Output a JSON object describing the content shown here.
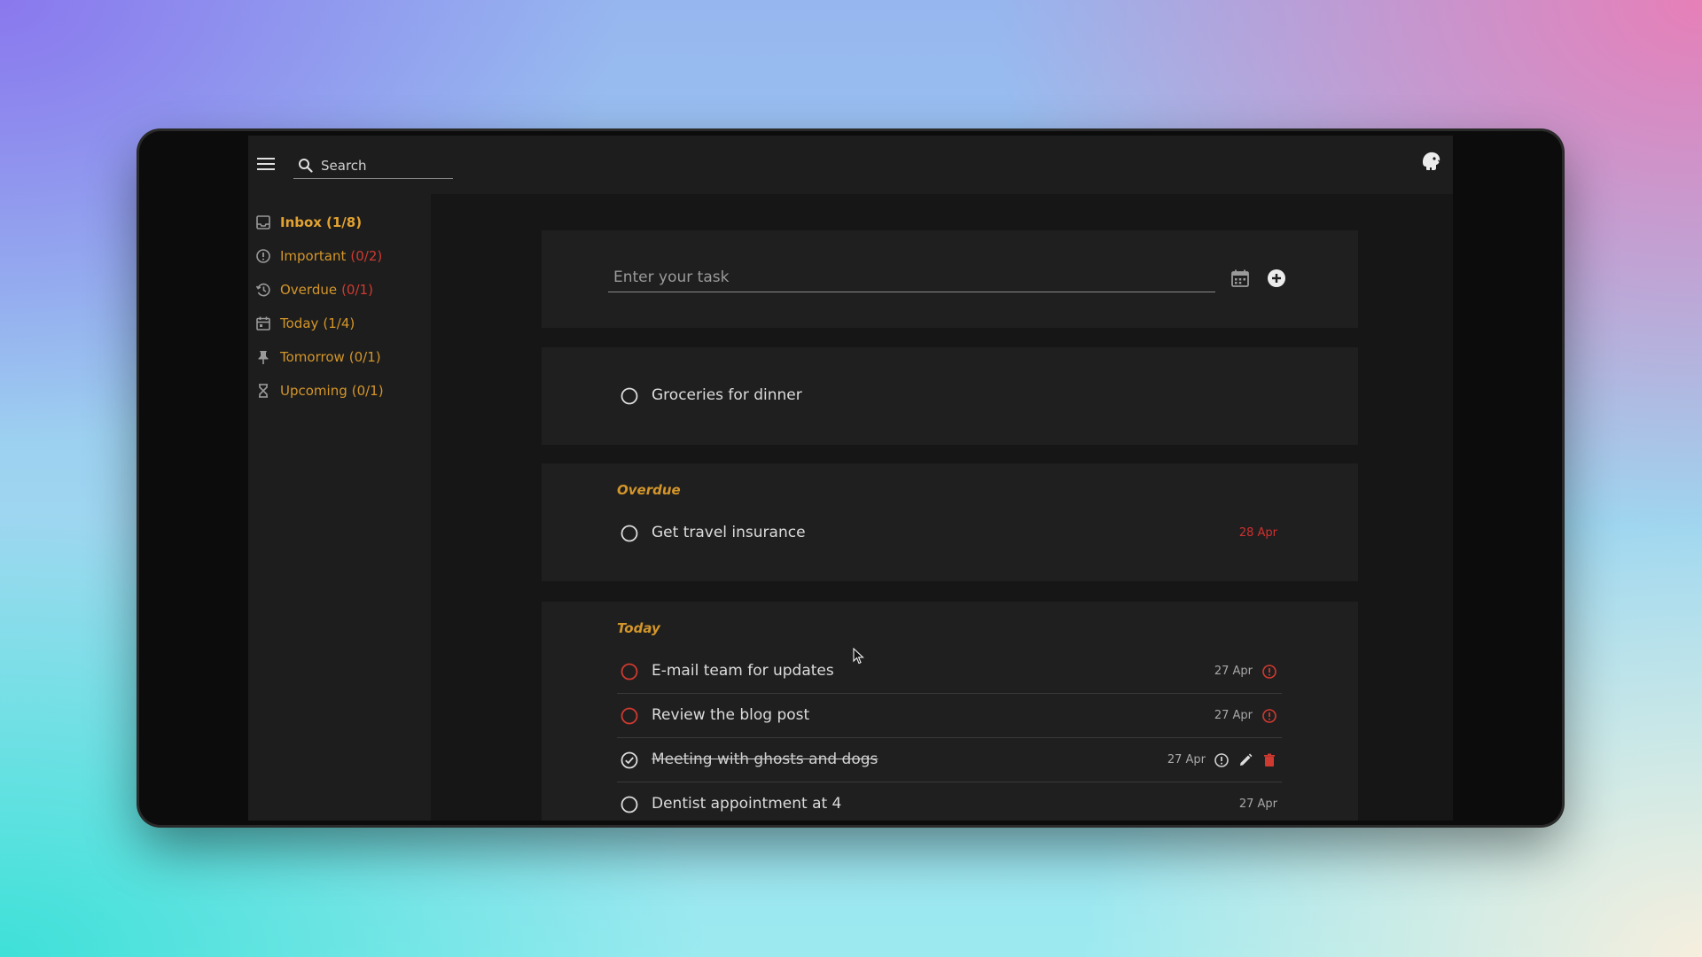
{
  "search": {
    "placeholder": "Search"
  },
  "sidebar": {
    "items": [
      {
        "label": "Inbox",
        "count": "(1/8)",
        "icon": "inbox-icon"
      },
      {
        "label": "Important",
        "count": "(0/2)",
        "icon": "alert-circle-icon"
      },
      {
        "label": "Overdue",
        "count": "(0/1)",
        "icon": "history-icon"
      },
      {
        "label": "Today",
        "count": "(1/4)",
        "icon": "calendar-icon"
      },
      {
        "label": "Tomorrow",
        "count": "(0/1)",
        "icon": "pin-icon"
      },
      {
        "label": "Upcoming",
        "count": "(0/1)",
        "icon": "hourglass-icon"
      }
    ]
  },
  "composer": {
    "placeholder": "Enter your task"
  },
  "inbox_tasks": [
    {
      "title": "Groceries for dinner",
      "done": false
    }
  ],
  "overdue": {
    "heading": "Overdue",
    "tasks": [
      {
        "title": "Get travel insurance",
        "date": "28 Apr"
      }
    ]
  },
  "today": {
    "heading": "Today",
    "tasks": [
      {
        "title": "E-mail team for updates",
        "date": "27 Apr",
        "important": true,
        "done": false
      },
      {
        "title": "Review the blog post",
        "date": "27 Apr",
        "important": true,
        "done": false
      },
      {
        "title": "Meeting with ghosts and dogs",
        "date": "27 Apr",
        "important": false,
        "done": true
      },
      {
        "title": "Dentist appointment at 4",
        "date": "27 Apr",
        "important": false,
        "done": false
      }
    ]
  },
  "colors": {
    "accent": "#d4962a",
    "danger": "#cf3a30",
    "app_bg": "#161616",
    "panel_bg": "#1f1f1f"
  }
}
